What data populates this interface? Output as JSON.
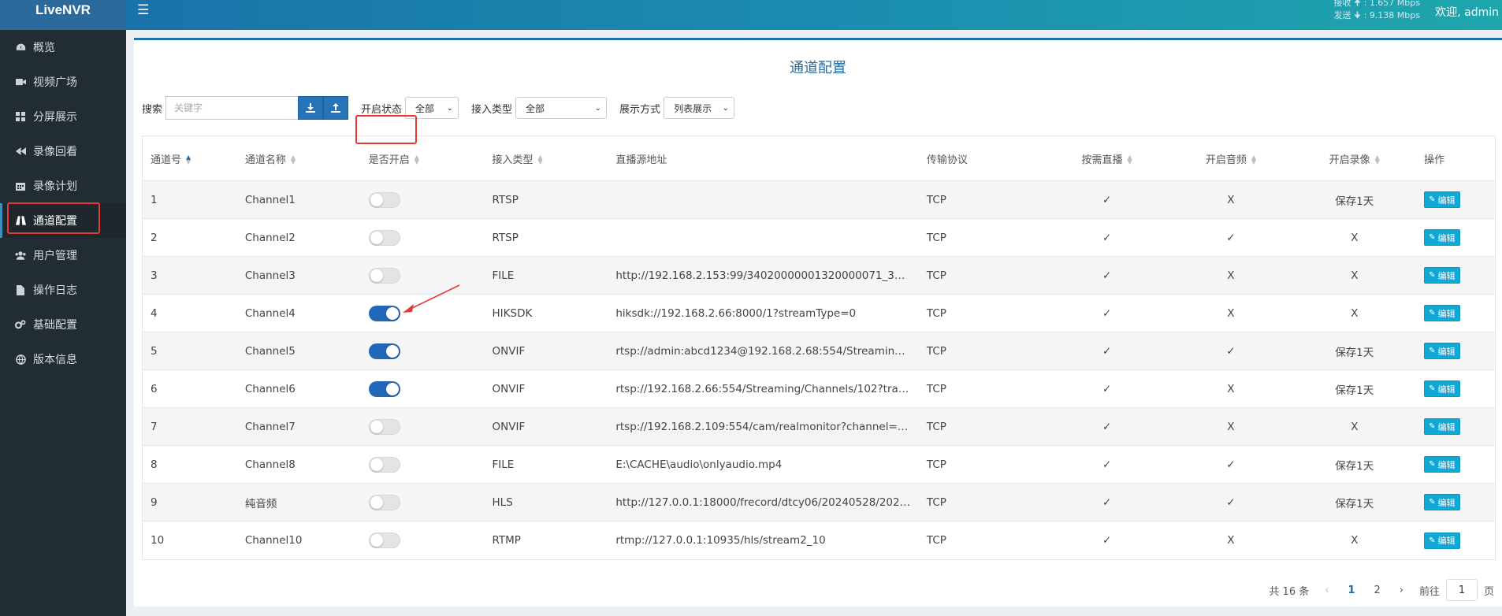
{
  "header": {
    "logo": "LiveNVR",
    "menu_icon": "hamburger-icon",
    "recv_label": "接收",
    "recv_value": "1.657 Mbps",
    "send_label": "发送",
    "send_value": "9.138 Mbps",
    "welcome": "欢迎, admin"
  },
  "sidebar": {
    "items": [
      {
        "label": "概览",
        "icon": "dashboard-icon"
      },
      {
        "label": "视频广场",
        "icon": "video-camera-icon"
      },
      {
        "label": "分屏展示",
        "icon": "grid-icon"
      },
      {
        "label": "录像回看",
        "icon": "rewind-icon"
      },
      {
        "label": "录像计划",
        "icon": "calendar-icon"
      },
      {
        "label": "通道配置",
        "icon": "road-icon"
      },
      {
        "label": "用户管理",
        "icon": "users-icon"
      },
      {
        "label": "操作日志",
        "icon": "file-icon"
      },
      {
        "label": "基础配置",
        "icon": "cogs-icon"
      },
      {
        "label": "版本信息",
        "icon": "globe-icon"
      }
    ]
  },
  "page": {
    "title": "通道配置"
  },
  "toolbar": {
    "search_label": "搜索",
    "search_placeholder": "关键字",
    "status_label": "开启状态",
    "status_value": "全部",
    "type_label": "接入类型",
    "type_value": "全部",
    "display_label": "展示方式",
    "display_value": "列表展示"
  },
  "table": {
    "columns": [
      "通道号",
      "通道名称",
      "是否开启",
      "接入类型",
      "直播源地址",
      "传输协议",
      "按需直播",
      "开启音频",
      "开启录像",
      "操作"
    ],
    "edit_label": "编辑",
    "rows": [
      {
        "id": "1",
        "name": "Channel1",
        "enabled": false,
        "type": "RTSP",
        "url": "",
        "proto": "TCP",
        "ondemand": "✓",
        "audio": "X",
        "record": "保存1天"
      },
      {
        "id": "2",
        "name": "Channel2",
        "enabled": false,
        "type": "RTSP",
        "url": "",
        "proto": "TCP",
        "ondemand": "✓",
        "audio": "✓",
        "record": "X"
      },
      {
        "id": "3",
        "name": "Channel3",
        "enabled": false,
        "type": "FILE",
        "url": "http://192.168.2.153:99/34020000001320000071_34020…",
        "proto": "TCP",
        "ondemand": "✓",
        "audio": "X",
        "record": "X"
      },
      {
        "id": "4",
        "name": "Channel4",
        "enabled": true,
        "type": "HIKSDK",
        "url": "hiksdk://192.168.2.66:8000/1?streamType=0",
        "proto": "TCP",
        "ondemand": "✓",
        "audio": "X",
        "record": "X"
      },
      {
        "id": "5",
        "name": "Channel5",
        "enabled": true,
        "type": "ONVIF",
        "url": "rtsp://admin:abcd1234@192.168.2.68:554/Streaming/Ch…",
        "proto": "TCP",
        "ondemand": "✓",
        "audio": "✓",
        "record": "保存1天"
      },
      {
        "id": "6",
        "name": "Channel6",
        "enabled": true,
        "type": "ONVIF",
        "url": "rtsp://192.168.2.66:554/Streaming/Channels/102?transpo…",
        "proto": "TCP",
        "ondemand": "✓",
        "audio": "X",
        "record": "保存1天"
      },
      {
        "id": "7",
        "name": "Channel7",
        "enabled": false,
        "type": "ONVIF",
        "url": "rtsp://192.168.2.109:554/cam/realmonitor?channel=1&su…",
        "proto": "TCP",
        "ondemand": "✓",
        "audio": "X",
        "record": "X"
      },
      {
        "id": "8",
        "name": "Channel8",
        "enabled": false,
        "type": "FILE",
        "url": "E:\\CACHE\\audio\\onlyaudio.mp4",
        "proto": "TCP",
        "ondemand": "✓",
        "audio": "✓",
        "record": "保存1天"
      },
      {
        "id": "9",
        "name": "纯音频",
        "enabled": false,
        "type": "HLS",
        "url": "http://127.0.0.1:18000/frecord/dtcy06/20240528/2024052…",
        "proto": "TCP",
        "ondemand": "✓",
        "audio": "✓",
        "record": "保存1天"
      },
      {
        "id": "10",
        "name": "Channel10",
        "enabled": false,
        "type": "RTMP",
        "url": "rtmp://127.0.0.1:10935/hls/stream2_10",
        "proto": "TCP",
        "ondemand": "✓",
        "audio": "X",
        "record": "X"
      }
    ]
  },
  "pagination": {
    "total": "共 16 条",
    "prev": "‹",
    "pages": [
      "1",
      "2"
    ],
    "current": "1",
    "next": "›",
    "goto_label": "前往",
    "goto_value": "1",
    "goto_suffix": "页"
  },
  "colors": {
    "header_start": "#1a6ea8",
    "header_end": "#1fa6ad",
    "sidebar_bg": "#222d32",
    "toggle_on": "#2266b8",
    "edit_button": "#12a8d6",
    "annotation_red": "#e53935"
  }
}
